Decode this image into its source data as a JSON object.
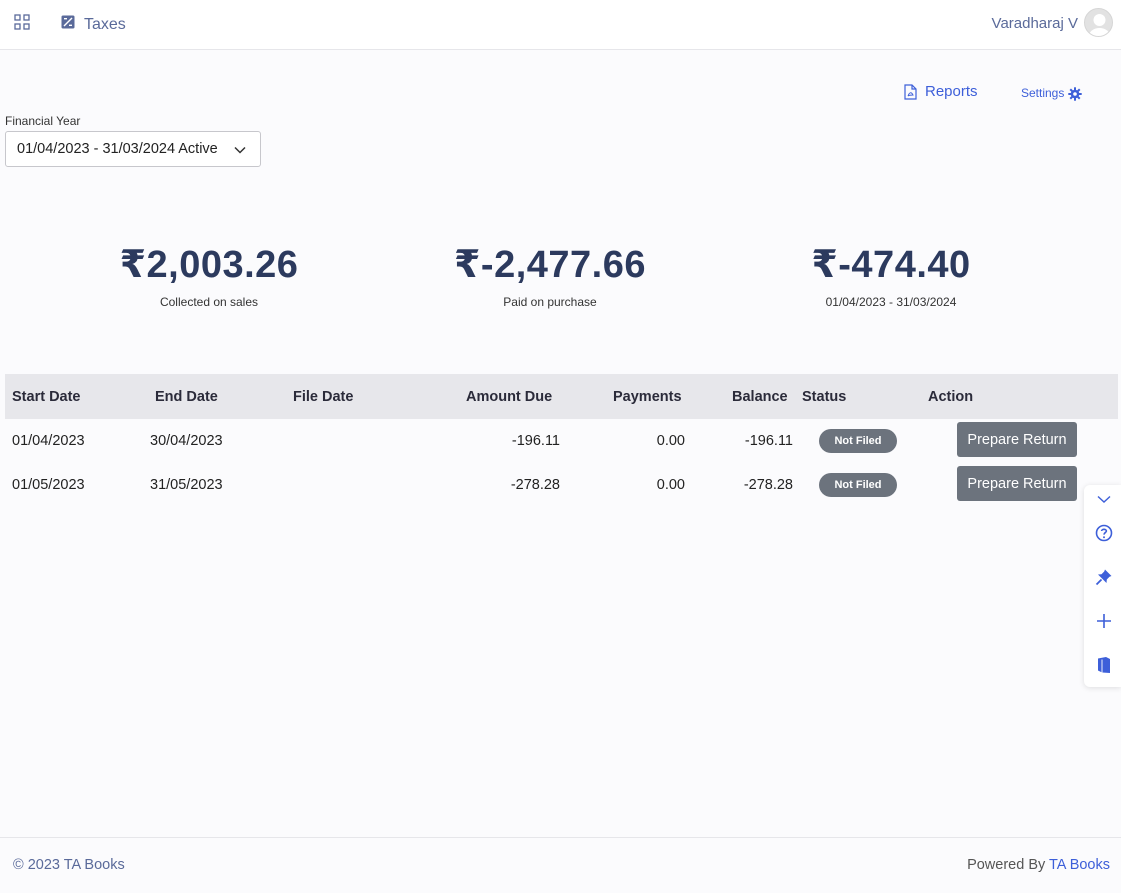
{
  "header": {
    "module_title": "Taxes",
    "user_name": "Varadharaj V",
    "icons": {
      "apps": "grid-icon",
      "module": "taxes-icon",
      "avatar": "user-avatar"
    }
  },
  "toolbar": {
    "reports_label": "Reports",
    "settings_label": "Settings",
    "reports_icon": "pdf-file-icon",
    "settings_icon": "gear-icon"
  },
  "financial_year": {
    "label": "Financial Year",
    "selected": "01/04/2023 - 31/03/2024  Active"
  },
  "summary": [
    {
      "amount": "₹2,003.26",
      "caption": "Collected on sales"
    },
    {
      "amount": "₹-2,477.66",
      "caption": "Paid on purchase"
    },
    {
      "amount": "₹-474.40",
      "caption": "01/04/2023 - 31/03/2024"
    }
  ],
  "table": {
    "columns": [
      "Start Date",
      "End Date",
      "File Date",
      "Amount Due",
      "Payments",
      "Balance",
      "Status",
      "Action"
    ],
    "rows": [
      {
        "start_date": "01/04/2023",
        "end_date": "30/04/2023",
        "file_date": "",
        "amount_due": "-196.11",
        "payments": "0.00",
        "balance": "-196.11",
        "status": "Not Filed",
        "action": "Prepare Return"
      },
      {
        "start_date": "01/05/2023",
        "end_date": "31/05/2023",
        "file_date": "",
        "amount_due": "-278.28",
        "payments": "0.00",
        "balance": "-278.28",
        "status": "Not Filed",
        "action": "Prepare Return"
      }
    ]
  },
  "side_tools": [
    "chevron-down-icon",
    "help-icon",
    "pin-icon",
    "plus-icon",
    "book-icon"
  ],
  "footer": {
    "copyright": "© 2023 TA Books",
    "powered_by": "Powered By ",
    "brand": "TA Books"
  },
  "colors": {
    "accent": "#3d5fd9",
    "header_text": "#5a6a9a",
    "amount_text": "#2c3a5e",
    "badge": "#6c737d",
    "table_header_bg": "#e7e7eb"
  }
}
